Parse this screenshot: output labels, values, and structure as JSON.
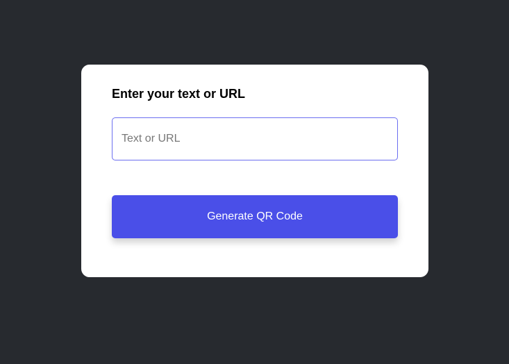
{
  "form": {
    "title": "Enter your text or URL",
    "input_value": "",
    "input_placeholder": "Text or URL",
    "button_label": "Generate QR Code"
  },
  "colors": {
    "background": "#272a2f",
    "accent": "#4a4fe8"
  }
}
